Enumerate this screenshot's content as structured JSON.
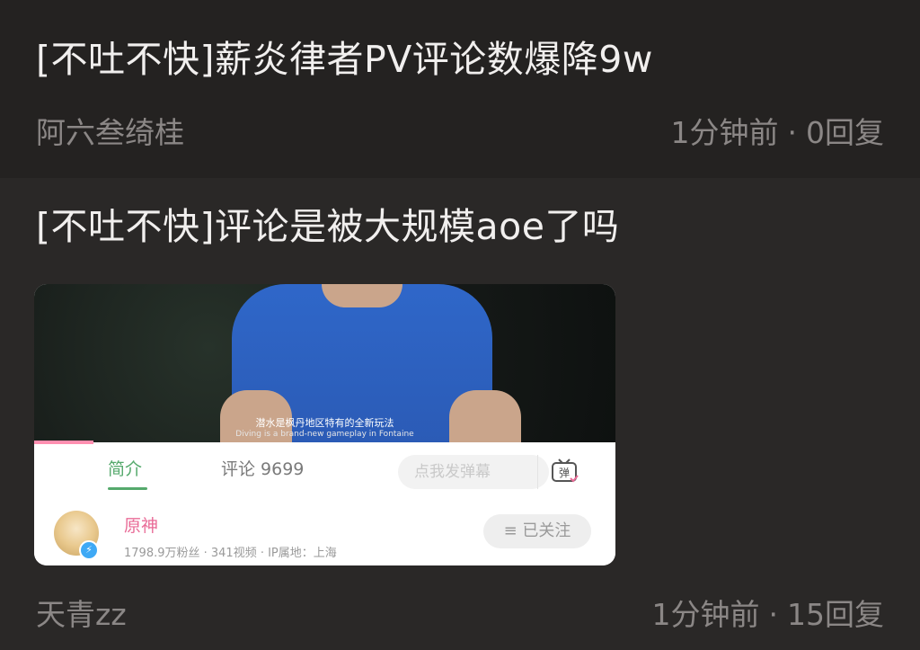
{
  "posts": [
    {
      "title": "[不吐不快]薪炎律者PV评论数爆降9w",
      "author": "阿六叁绮桂",
      "time": "1分钟前",
      "separator": "·",
      "replies": "0回复"
    },
    {
      "title": "[不吐不快]评论是被大规模aoe了吗",
      "author": "天青zz",
      "time": "1分钟前",
      "separator": "·",
      "replies": "15回复",
      "thumbnail": {
        "subtitle_cn": "潜水是枫丹地区特有的全新玩法",
        "subtitle_en": "Diving is a brand-new gameplay in Fontaine",
        "tabs": {
          "intro": "简介",
          "comments": "评论 9699"
        },
        "danmu_placeholder": "点我发弹幕",
        "danmu_icon_text": "弹",
        "channel": {
          "name": "原神",
          "stats": "1798.9万粉丝 · 341视频 · IP属地：上海",
          "follow_label": "≡ 已关注"
        }
      }
    }
  ],
  "colors": {
    "background": "#2a2827",
    "text_primary": "#f1efee",
    "text_secondary": "#8b8786",
    "accent_green": "#55a96c",
    "accent_pink": "#e96b97"
  }
}
